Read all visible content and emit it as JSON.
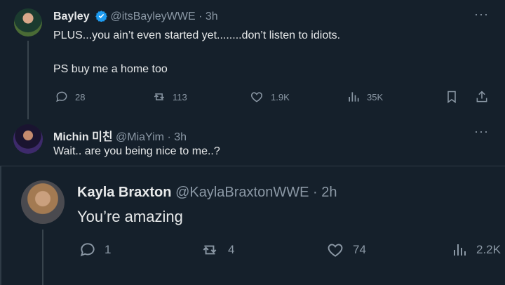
{
  "tweets": [
    {
      "name": "Bayley",
      "handle": "@itsBayleyWWE",
      "time": "3h",
      "line1": "PLUS...you ain’t even started yet........don’t listen to idiots.",
      "line2": "PS buy me a home too",
      "replies": "28",
      "retweets": "113",
      "likes": "1.9K",
      "views": "35K"
    },
    {
      "name": "Michin 미친",
      "handle": "@MiaYim",
      "time": "3h",
      "line1": "Wait.. are you being nice to me..?"
    },
    {
      "name": "Kayla Braxton",
      "handle": "@KaylaBraxtonWWE",
      "time": "2h",
      "line1": "You’re amazing",
      "replies": "1",
      "retweets": "4",
      "likes": "74",
      "views": "2.2K"
    }
  ],
  "colors": {
    "background": "#15202b",
    "text": "#e7e9ea",
    "muted": "#8b98a5",
    "verified": "#1d9bf0"
  },
  "icons": [
    "more-icon",
    "reply-icon",
    "retweet-icon",
    "like-icon",
    "views-icon",
    "bookmark-icon",
    "share-icon",
    "verified-badge-icon"
  ]
}
